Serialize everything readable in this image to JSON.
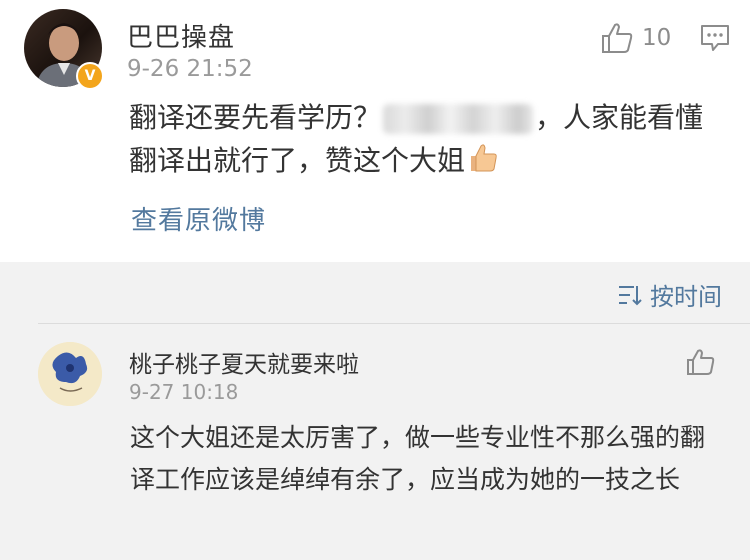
{
  "post": {
    "author": "巴巴操盘",
    "verified_badge": "V",
    "timestamp": "9-26 21:52",
    "like_count": "10",
    "text_part1": "翻译还要先看学历？",
    "text_part2": "，人家能看懂翻译出就行了，赞这个大姐",
    "view_original": "查看原微博"
  },
  "comments_header": {
    "sort_label": "按时间"
  },
  "comment": {
    "author": "桃子桃子夏天就要来啦",
    "timestamp": "9-27 10:18",
    "text": "这个大姐还是太厉害了，做一些专业性不那么强的翻译工作应该是绰绰有余了，应当成为她的一技之长"
  },
  "colors": {
    "link": "#53799e",
    "badge": "#f3a51c",
    "comments_bg": "#f2f2f2"
  }
}
